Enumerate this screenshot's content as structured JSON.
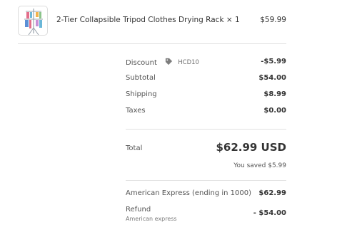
{
  "line_item": {
    "title": "2-Tier Collapsible Tripod Clothes Drying Rack",
    "quantity": "× 1",
    "price": "$59.99",
    "image_icon": "clothes-drying-rack-thumbnail"
  },
  "summary": {
    "discount": {
      "label": "Discount",
      "code_icon": "tag-icon",
      "code": "HCD10",
      "value": "-$5.99"
    },
    "subtotal": {
      "label": "Subtotal",
      "value": "$54.00"
    },
    "shipping": {
      "label": "Shipping",
      "value": "$8.99"
    },
    "taxes": {
      "label": "Taxes",
      "value": "$0.00"
    }
  },
  "total": {
    "label": "Total",
    "value": "$62.99 USD",
    "saved": "You saved $5.99"
  },
  "payments": {
    "charge": {
      "label": "American Express (ending in 1000)",
      "value": "$62.99"
    },
    "refund": {
      "label": "Refund",
      "sublabel": "American express",
      "value": "- $54.00"
    }
  },
  "colors": {
    "text": "#333333",
    "muted": "#545454",
    "divider": "#e1e1e1",
    "border": "#dcdcdc"
  }
}
